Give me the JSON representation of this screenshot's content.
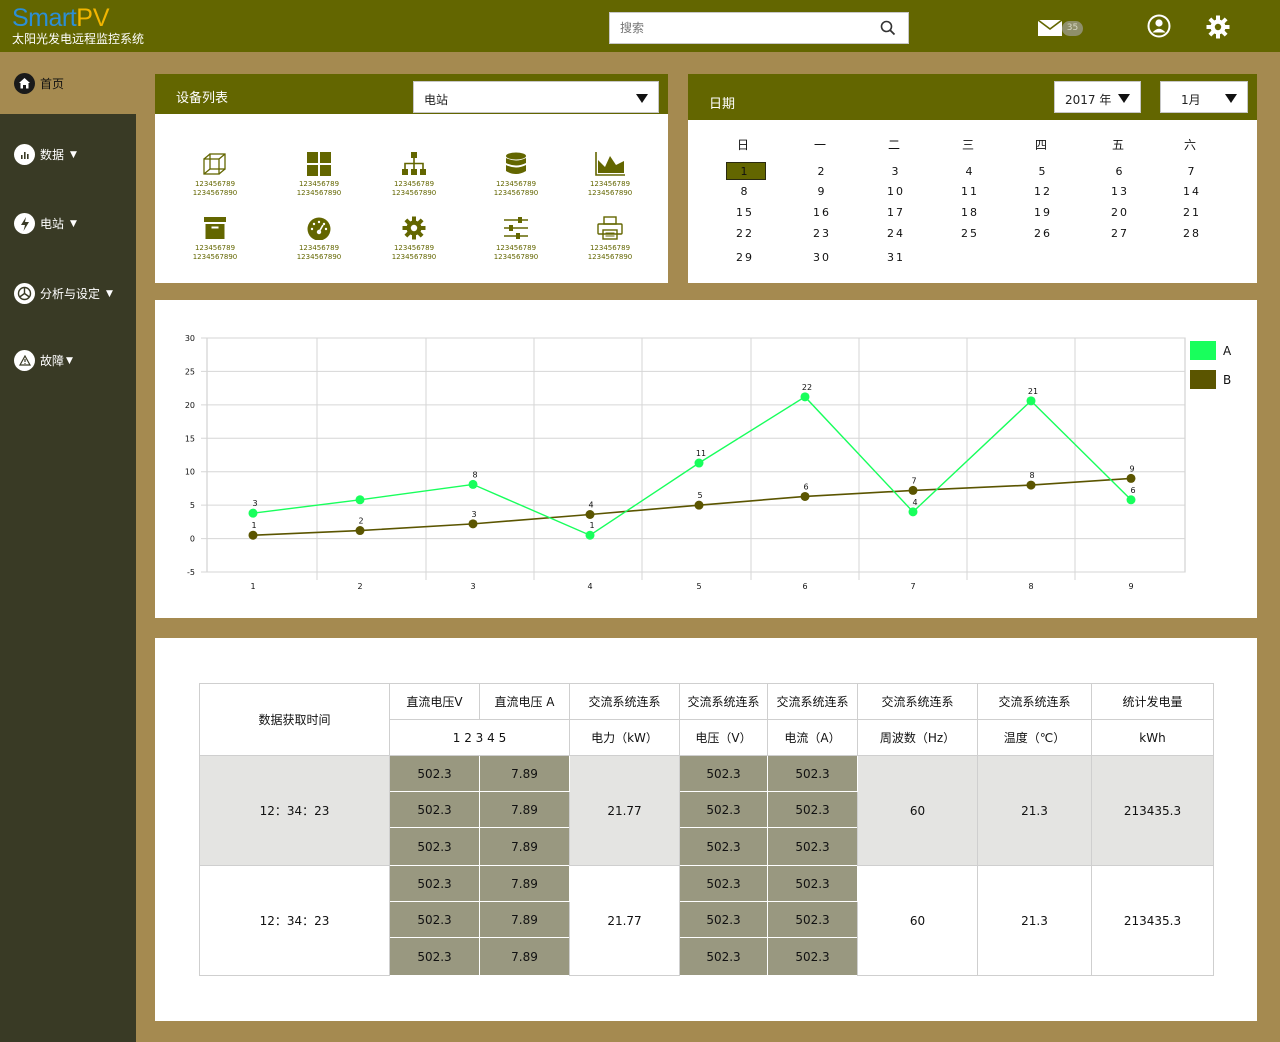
{
  "app": {
    "logo_part1": "Smart",
    "logo_part2": "PV",
    "subtitle": "太阳光发电远程监控系统"
  },
  "topbar": {
    "search_placeholder": "搜索",
    "mail_badge": "35"
  },
  "sidebar": {
    "items": [
      {
        "label": "首页",
        "icon": "home-icon",
        "active": true
      },
      {
        "label": "数据",
        "icon": "bar-chart-icon",
        "caret": "▼"
      },
      {
        "label": "电站",
        "icon": "lightning-icon",
        "caret": "▼"
      },
      {
        "label": "分析与设定",
        "icon": "pie-chart-icon",
        "caret": "▼"
      },
      {
        "label": "故障",
        "icon": "warning-icon",
        "caret": "▼"
      }
    ]
  },
  "device_panel": {
    "title": "设备列表",
    "select_value": "电站",
    "devices": [
      {
        "icon": "cube-icon",
        "line1": "123456789",
        "line2": "1234567890"
      },
      {
        "icon": "grid-icon",
        "line1": "123456789",
        "line2": "1234567890"
      },
      {
        "icon": "hierarchy-icon",
        "line1": "123456789",
        "line2": "1234567890"
      },
      {
        "icon": "database-icon",
        "line1": "123456789",
        "line2": "1234567890"
      },
      {
        "icon": "area-chart-icon",
        "line1": "123456789",
        "line2": "1234567890"
      },
      {
        "icon": "archive-icon",
        "line1": "123456789",
        "line2": "1234567890"
      },
      {
        "icon": "gauge-icon",
        "line1": "123456789",
        "line2": "1234567890"
      },
      {
        "icon": "gear-icon",
        "line1": "123456789",
        "line2": "1234567890"
      },
      {
        "icon": "sliders-icon",
        "line1": "123456789",
        "line2": "1234567890"
      },
      {
        "icon": "printer-icon",
        "line1": "123456789",
        "line2": "1234567890"
      }
    ]
  },
  "calendar_panel": {
    "title": "日期",
    "year_value": "2017 年",
    "month_value": "1月",
    "weekdays": [
      "日",
      "一",
      "二",
      "三",
      "四",
      "五",
      "六"
    ],
    "weeks": [
      [
        "1",
        "2",
        "3",
        "4",
        "5",
        "6",
        "7"
      ],
      [
        "8",
        "9",
        "10",
        "11",
        "12",
        "13",
        "14"
      ],
      [
        "15",
        "16",
        "17",
        "18",
        "19",
        "20",
        "21"
      ],
      [
        "22",
        "23",
        "24",
        "25",
        "26",
        "27",
        "28"
      ],
      [
        "29",
        "30",
        "31",
        "",
        "",
        "",
        ""
      ]
    ],
    "selected": "1"
  },
  "chart_data": {
    "type": "line",
    "title": "",
    "xlabel": "",
    "ylabel": "",
    "x": [
      1,
      2,
      3,
      4,
      5,
      6,
      7,
      8,
      9
    ],
    "ylim": [
      -5,
      30
    ],
    "yticks": [
      -5,
      0,
      5,
      10,
      15,
      20,
      25,
      30
    ],
    "grid": true,
    "legend": "right",
    "series": [
      {
        "name": "A",
        "color": "#18ff5c",
        "values": [
          3.8,
          5.8,
          8.1,
          0.5,
          11.3,
          21.2,
          4.0,
          20.6,
          5.8
        ],
        "labels": [
          "3",
          "",
          "8",
          "1",
          "11",
          "22",
          "4",
          "21",
          "6"
        ]
      },
      {
        "name": "B",
        "color": "#5b5500",
        "values": [
          0.5,
          1.2,
          2.2,
          3.6,
          5.0,
          6.3,
          7.2,
          8.0,
          9.0
        ],
        "labels": [
          "1",
          "2",
          "3",
          "4",
          "5",
          "6",
          "7",
          "8",
          "9"
        ]
      }
    ]
  },
  "table": {
    "col_time": "数据获取时间",
    "h_dcv": "直流电压V",
    "h_dca": "直流电压 A",
    "h_dc_sub": "1 2 3 4 5",
    "h_acp1": "交流系统连系",
    "h_acp2": "电力（kW）",
    "h_acv1": "交流系统连系",
    "h_acv2": "电压（V）",
    "h_aci1": "交流系统连系",
    "h_aci2": "电流（A）",
    "h_acf1": "交流系统连系",
    "h_acf2": "周波数（Hz）",
    "h_act1": "交流系统连系",
    "h_act2": "温度（℃）",
    "h_tot1": "统计发电量",
    "h_tot2": "kWh",
    "rows": [
      {
        "time": "12：34：23",
        "dcv": [
          "502.3",
          "502.3",
          "502.3"
        ],
        "dca": [
          "7.89",
          "7.89",
          "7.89"
        ],
        "power": "21.77",
        "acv": [
          "502.3",
          "502.3",
          "502.3"
        ],
        "aci": [
          "502.3",
          "502.3",
          "502.3"
        ],
        "freq": "60",
        "temp": "21.3",
        "total": "213435.3"
      },
      {
        "time": "12：34：23",
        "dcv": [
          "502.3",
          "502.3",
          "502.3"
        ],
        "dca": [
          "7.89",
          "7.89",
          "7.89"
        ],
        "power": "21.77",
        "acv": [
          "502.3",
          "502.3",
          "502.3"
        ],
        "aci": [
          "502.3",
          "502.3",
          "502.3"
        ],
        "freq": "60",
        "temp": "21.3",
        "total": "213435.3"
      }
    ]
  }
}
